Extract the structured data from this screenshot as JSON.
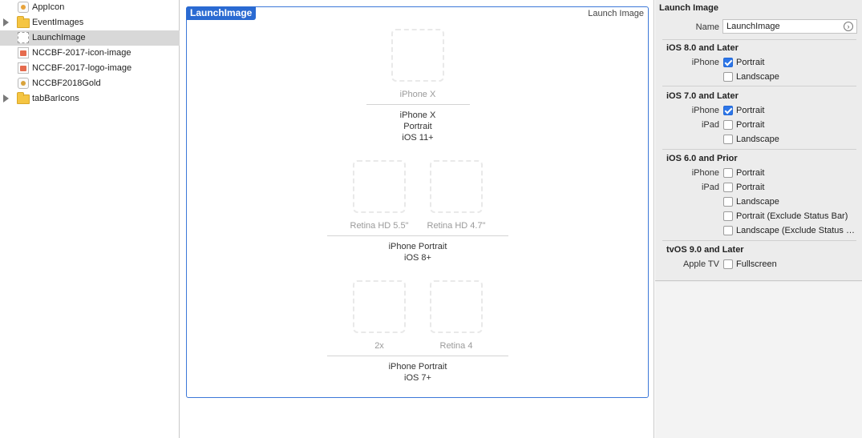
{
  "navigator": {
    "items": [
      {
        "label": "AppIcon",
        "icon": "app-icon-set",
        "expandable": false,
        "selected": false
      },
      {
        "label": "EventImages",
        "icon": "folder",
        "expandable": true,
        "selected": false
      },
      {
        "label": "LaunchImage",
        "icon": "launch-image-set",
        "expandable": false,
        "selected": true
      },
      {
        "label": "NCCBF-2017-icon-image",
        "icon": "image-set",
        "expandable": false,
        "selected": false
      },
      {
        "label": "NCCBF-2017-logo-image",
        "icon": "image-set",
        "expandable": false,
        "selected": false
      },
      {
        "label": "NCCBF2018Gold",
        "icon": "app-icon-set",
        "expandable": false,
        "selected": false
      },
      {
        "label": "tabBarIcons",
        "icon": "folder",
        "expandable": true,
        "selected": false
      }
    ]
  },
  "editor": {
    "set_name": "LaunchImage",
    "set_type": "Launch Image",
    "accent_color": "#2a6ad2",
    "groups": [
      {
        "slots": [
          "iPhone X"
        ],
        "caption": [
          "iPhone X",
          "Portrait",
          "iOS 11+"
        ]
      },
      {
        "slots": [
          "Retina HD 5.5\"",
          "Retina HD 4.7\""
        ],
        "caption": [
          "iPhone Portrait",
          "iOS 8+"
        ]
      },
      {
        "slots": [
          "2x",
          "Retina 4"
        ],
        "caption": [
          "iPhone Portrait",
          "iOS 7+"
        ]
      }
    ]
  },
  "inspector": {
    "heading": "Launch Image",
    "name_label": "Name",
    "name_value": "LaunchImage",
    "sections": [
      {
        "title": "iOS 8.0 and Later",
        "rows": [
          {
            "platform": "iPhone",
            "label": "Portrait",
            "checked": true
          },
          {
            "platform": "",
            "label": "Landscape",
            "checked": false
          }
        ]
      },
      {
        "title": "iOS 7.0 and Later",
        "rows": [
          {
            "platform": "iPhone",
            "label": "Portrait",
            "checked": true
          },
          {
            "platform": "iPad",
            "label": "Portrait",
            "checked": false
          },
          {
            "platform": "",
            "label": "Landscape",
            "checked": false
          }
        ]
      },
      {
        "title": "iOS 6.0 and Prior",
        "rows": [
          {
            "platform": "iPhone",
            "label": "Portrait",
            "checked": false
          },
          {
            "platform": "iPad",
            "label": "Portrait",
            "checked": false
          },
          {
            "platform": "",
            "label": "Landscape",
            "checked": false
          },
          {
            "platform": "",
            "label": "Portrait (Exclude Status Bar)",
            "checked": false
          },
          {
            "platform": "",
            "label": "Landscape (Exclude Status Bar)",
            "checked": false
          }
        ]
      },
      {
        "title": "tvOS 9.0 and Later",
        "rows": [
          {
            "platform": "Apple TV",
            "label": "Fullscreen",
            "checked": false
          }
        ]
      }
    ]
  }
}
